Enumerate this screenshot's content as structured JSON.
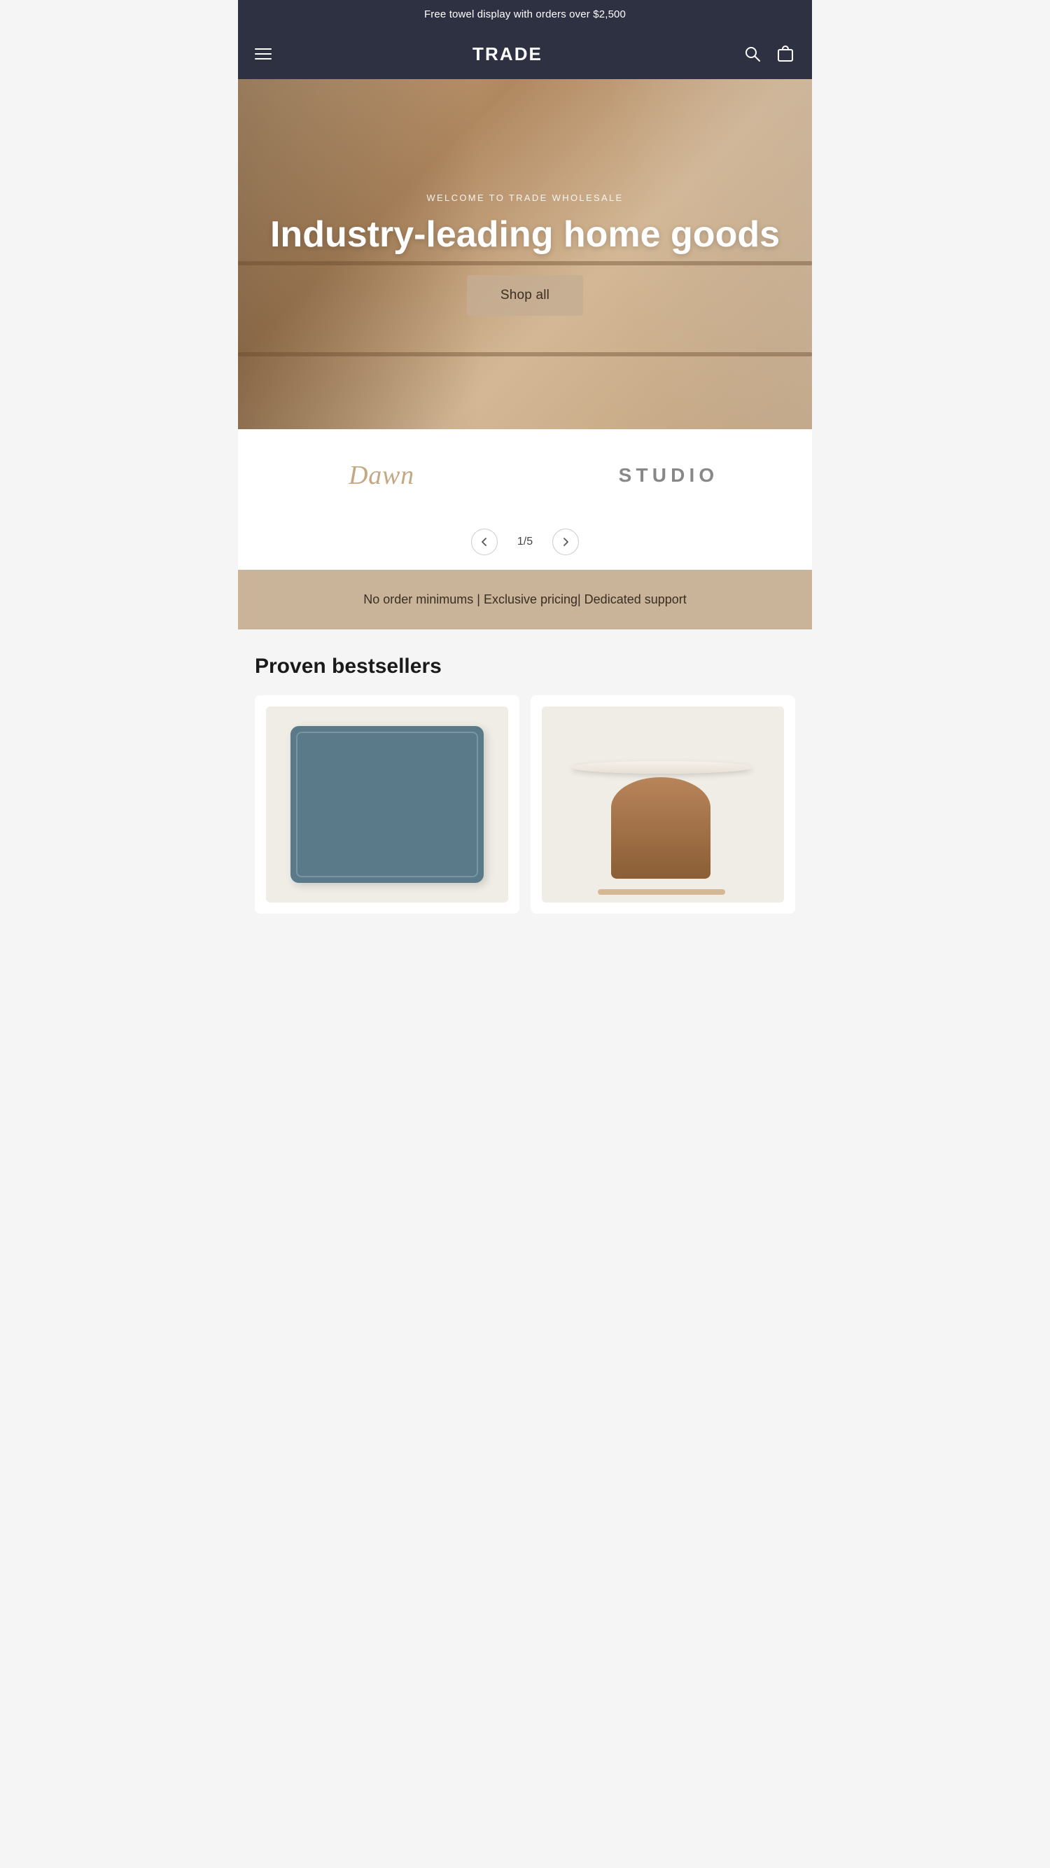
{
  "announcement": {
    "text": "Free towel display with orders over $2,500"
  },
  "header": {
    "logo": "TRADE",
    "menu_icon_label": "Menu",
    "search_icon_label": "Search",
    "cart_icon_label": "Cart"
  },
  "hero": {
    "subtitle": "WELCOME TO TRADE WHOLESALE",
    "title": "Industry-leading home goods",
    "cta_label": "Shop all"
  },
  "brands": [
    {
      "name": "Dawn",
      "style": "serif-italic"
    },
    {
      "name": "STUDIO",
      "style": "sans-uppercase"
    }
  ],
  "carousel": {
    "current": "1",
    "total": "5",
    "separator": "/",
    "prev_label": "‹",
    "next_label": "›"
  },
  "features": {
    "text": "No order minimums | Exclusive pricing| Dedicated support"
  },
  "bestsellers": {
    "section_title": "Proven bestsellers",
    "products": [
      {
        "id": "pillow",
        "type": "pillow",
        "alt": "Blue pillow"
      },
      {
        "id": "side-table",
        "type": "table",
        "alt": "Marble side table"
      }
    ]
  }
}
